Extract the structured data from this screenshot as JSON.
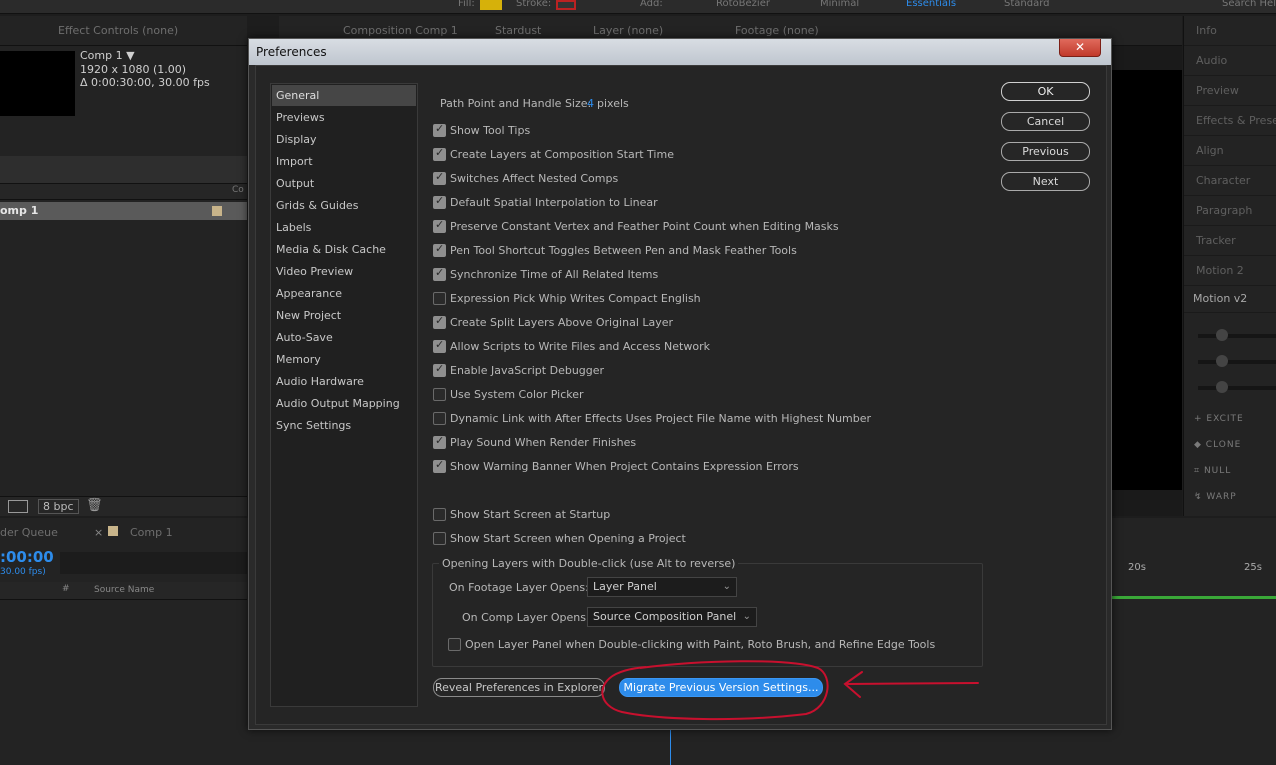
{
  "topbar": {
    "fill_label": "Fill:",
    "stroke_label": "Stroke:",
    "add_label": "Add:",
    "rotobezier_label": "RotoBezier",
    "workspaces": [
      "Minimal",
      "Essentials",
      "Standard"
    ],
    "search_placeholder": "Search Hel"
  },
  "left_panel": {
    "tab_label": "Effect Controls (none)",
    "comp_name": "Comp 1 ▼",
    "comp_res": "1920 x 1080 (1.00)",
    "comp_duration": "Δ 0:00:30:00, 30.00 fps",
    "col_partial": "Co",
    "item_name": "omp 1",
    "bpc": "8 bpc"
  },
  "comp_panel": {
    "tabs": [
      "Composition Comp 1",
      "Stardust",
      "Layer (none)",
      "Footage (none)"
    ]
  },
  "timeline": {
    "queue_tab": "der Queue",
    "comp_tab": "Comp 1",
    "timecode": ":00:00",
    "fps": "30.00 fps)",
    "source_name_header": "Source Name",
    "hash_header": "#",
    "ruler_labels": [
      "20s",
      "25s"
    ]
  },
  "right_panel": {
    "items": [
      "Info",
      "Audio",
      "Preview",
      "Effects & Presets",
      "Align",
      "Character",
      "Paragraph",
      "Tracker",
      "Motion 2",
      "Motion v2"
    ],
    "motion_buttons": [
      "EXCITE",
      "CLONE",
      "NULL",
      "WARP"
    ]
  },
  "dialog": {
    "title": "Preferences",
    "close_glyph": "✕",
    "categories": [
      {
        "label": "General",
        "selected": true
      },
      {
        "label": "Previews",
        "selected": false
      },
      {
        "label": "Display",
        "selected": false
      },
      {
        "label": "Import",
        "selected": false
      },
      {
        "label": "Output",
        "selected": false
      },
      {
        "label": "Grids & Guides",
        "selected": false
      },
      {
        "label": "Labels",
        "selected": false
      },
      {
        "label": "Media & Disk Cache",
        "selected": false
      },
      {
        "label": "Video Preview",
        "selected": false
      },
      {
        "label": "Appearance",
        "selected": false
      },
      {
        "label": "New Project",
        "selected": false
      },
      {
        "label": "Auto-Save",
        "selected": false
      },
      {
        "label": "Memory",
        "selected": false
      },
      {
        "label": "Audio Hardware",
        "selected": false
      },
      {
        "label": "Audio Output Mapping",
        "selected": false
      },
      {
        "label": "Sync Settings",
        "selected": false
      }
    ],
    "path_point": {
      "label": "Path Point and Handle Size:",
      "value": "4",
      "unit": "pixels"
    },
    "checkboxes": [
      {
        "label": "Show Tool Tips",
        "checked": true
      },
      {
        "label": "Create Layers at Composition Start Time",
        "checked": true
      },
      {
        "label": "Switches Affect Nested Comps",
        "checked": true
      },
      {
        "label": "Default Spatial Interpolation to Linear",
        "checked": true
      },
      {
        "label": "Preserve Constant Vertex and Feather Point Count when Editing Masks",
        "checked": true
      },
      {
        "label": "Pen Tool Shortcut Toggles Between Pen and Mask Feather Tools",
        "checked": true
      },
      {
        "label": "Synchronize Time of All Related Items",
        "checked": true
      },
      {
        "label": "Expression Pick Whip Writes Compact English",
        "checked": false
      },
      {
        "label": "Create Split Layers Above Original Layer",
        "checked": true
      },
      {
        "label": "Allow Scripts to Write Files and Access Network",
        "checked": true
      },
      {
        "label": "Enable JavaScript Debugger",
        "checked": true
      },
      {
        "label": "Use System Color Picker",
        "checked": false
      },
      {
        "label": "Dynamic Link with After Effects Uses Project File Name with Highest Number",
        "checked": false
      },
      {
        "label": "Play Sound When Render Finishes",
        "checked": true
      },
      {
        "label": "Show Warning Banner When Project Contains Expression Errors",
        "checked": true
      }
    ],
    "startup_checkboxes": [
      {
        "label": "Show Start Screen at Startup",
        "checked": false
      },
      {
        "label": "Show Start Screen when Opening a Project",
        "checked": false
      }
    ],
    "opening_group": {
      "title": "Opening Layers with Double-click (use Alt to reverse)",
      "footage_label": "On Footage Layer Opens:",
      "footage_value": "Layer Panel",
      "comp_label": "On Comp Layer Opens:",
      "comp_value": "Source Composition Panel",
      "open_layer_label": "Open Layer Panel when Double-clicking with Paint, Roto Brush, and Refine Edge Tools",
      "open_layer_checked": false
    },
    "buttons": {
      "ok": "OK",
      "cancel": "Cancel",
      "previous": "Previous",
      "next": "Next",
      "reveal": "Reveal Preferences in Explorer",
      "migrate": "Migrate Previous Version Settings..."
    },
    "colors": {
      "accent": "#2d8ceb",
      "annotation": "#c8102e"
    }
  }
}
